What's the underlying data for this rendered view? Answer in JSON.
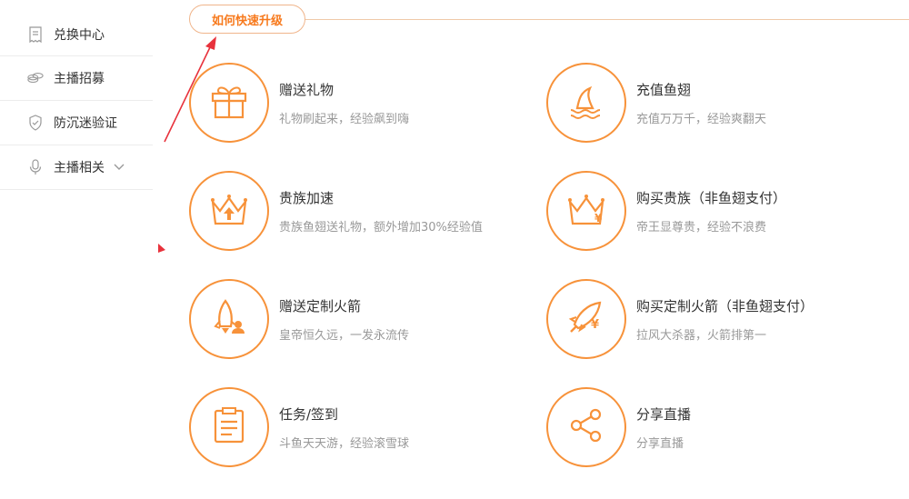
{
  "sidebar": {
    "items": [
      {
        "label": "兑换中心",
        "icon": "receipt-icon"
      },
      {
        "label": "主播招募",
        "icon": "coins-icon"
      },
      {
        "label": "防沉迷验证",
        "icon": "shield-icon"
      },
      {
        "label": "主播相关",
        "icon": "microphone-icon"
      }
    ]
  },
  "header": {
    "title": "如何快速升级"
  },
  "cards": [
    {
      "title": "赠送礼物",
      "subtitle": "礼物刷起来，经验飙到嗨",
      "icon": "gift-icon"
    },
    {
      "title": "充值鱼翅",
      "subtitle": "充值万万千，经验爽翻天",
      "icon": "shark-fin-icon"
    },
    {
      "title": "贵族加速",
      "subtitle": "贵族鱼翅送礼物，额外增加30%经验值",
      "icon": "crown-up-icon"
    },
    {
      "title": "购买贵族（非鱼翅支付）",
      "subtitle": "帝王显尊贵，经验不浪费",
      "icon": "crown-yen-icon"
    },
    {
      "title": "赠送定制火箭",
      "subtitle": "皇帝恒久远，一发永流传",
      "icon": "rocket-person-icon"
    },
    {
      "title": "购买定制火箭（非鱼翅支付）",
      "subtitle": "拉风大杀器，火箭排第一",
      "icon": "rocket-yen-icon"
    },
    {
      "title": "任务/签到",
      "subtitle": "斗鱼天天游，经验滚雪球",
      "icon": "checklist-icon"
    },
    {
      "title": "分享直播",
      "subtitle": "分享直播",
      "icon": "share-icon"
    }
  ],
  "colors": {
    "accent": "#f7923a",
    "title_text": "#f7791c",
    "annotation": "#e8323c"
  }
}
